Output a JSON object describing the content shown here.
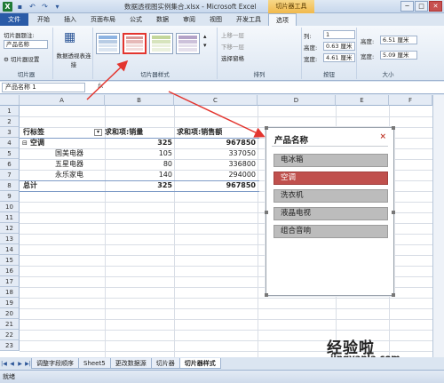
{
  "window": {
    "title": "数据透视图实例集合.xlsx - Microsoft Excel",
    "context_tool": "切片器工具",
    "controls": [
      "─",
      "□",
      "✕"
    ]
  },
  "ribbon_tabs": [
    "文件",
    "开始",
    "插入",
    "页面布局",
    "公式",
    "数据",
    "审阅",
    "视图",
    "开发工具",
    "选项"
  ],
  "ribbon": {
    "slicer_group": {
      "caption_label": "切片器题注:",
      "caption_value": "产品名称",
      "settings_label": "切片器设置",
      "group_label": "切片器"
    },
    "pivot_connections_label": "数据透视表连接",
    "styles_group_label": "切片器样式",
    "arrange": {
      "bring_forward": "上移一层",
      "send_backward": "下移一层",
      "selection_pane": "选择窗格",
      "group_label": "排列"
    },
    "buttons": {
      "columns_label": "列:",
      "columns_value": "1",
      "height_label": "高度:",
      "height_value": "0.63 厘米",
      "width_label": "宽度:",
      "width_value": "4.61 厘米",
      "group_label": "按钮"
    },
    "size": {
      "height_label": "高度:",
      "height_value": "6.51 厘米",
      "width_label": "宽度:",
      "width_value": "5.09 厘米",
      "group_label": "大小"
    }
  },
  "formula_bar": {
    "name_box": "产品名称 1",
    "fx": "fx"
  },
  "columns": [
    "A",
    "B",
    "C",
    "D",
    "E",
    "F"
  ],
  "rows": [
    "1",
    "2",
    "3",
    "4",
    "5",
    "6",
    "7",
    "8",
    "9",
    "10",
    "11",
    "12",
    "13",
    "14",
    "15",
    "16",
    "17",
    "18",
    "19",
    "20",
    "21",
    "22",
    "23"
  ],
  "pivot": {
    "row_label_header": "行标签",
    "sum_qty_header": "求和项:销量",
    "sum_sales_header": "求和项:销售额",
    "group_row": {
      "label": "空调",
      "qty": "325",
      "sales": "967850"
    },
    "detail_rows": [
      {
        "label": "国美电器",
        "qty": "105",
        "sales": "337050"
      },
      {
        "label": "五星电器",
        "qty": "80",
        "sales": "336800"
      },
      {
        "label": "永乐家电",
        "qty": "140",
        "sales": "294000"
      }
    ],
    "total_row": {
      "label": "总计",
      "qty": "325",
      "sales": "967850"
    }
  },
  "slicer": {
    "title": "产品名称",
    "items": [
      "电冰箱",
      "空调",
      "洗衣机",
      "液晶电视",
      "组合音响"
    ],
    "selected": "空调",
    "colors": {
      "selected": "#c0504d",
      "unselected": "#bcbcbc"
    }
  },
  "sheet_tabs": [
    "调整字段顺序",
    "Sheet5",
    "更改数据源",
    "切片器",
    "切片器样式"
  ],
  "active_sheet": "切片器样式",
  "status": "就绪",
  "watermark": {
    "text": "经验啦",
    "sub": "jingyanla.com"
  }
}
